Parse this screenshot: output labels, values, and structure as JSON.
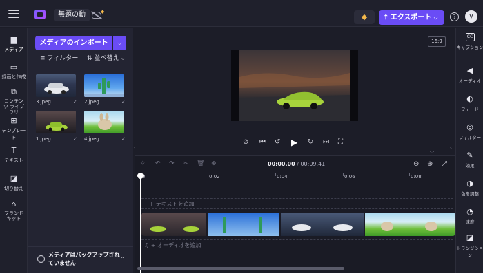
{
  "topbar": {
    "project_title": "無題の動",
    "export_label": "エクスポート",
    "avatar_initial": "y"
  },
  "leftnav": {
    "items": [
      {
        "label": "メディア",
        "icon": "folder-icon"
      },
      {
        "label": "録画と作成",
        "icon": "video-camera-icon"
      },
      {
        "label": "コンテンツ ライブラリ",
        "icon": "library-icon"
      },
      {
        "label": "テンプレート",
        "icon": "template-grid-icon"
      },
      {
        "label": "テキスト",
        "icon": "text-icon"
      },
      {
        "label": "切り替え",
        "icon": "transitions-icon"
      },
      {
        "label": "ブランド キット",
        "icon": "brand-kit-icon"
      }
    ]
  },
  "media": {
    "import_label": "メディアのインポート",
    "filter_label": "フィルター",
    "sort_label": "並べ替え",
    "files": [
      {
        "name": "3.jpeg",
        "check": "✓"
      },
      {
        "name": "2.jpeg",
        "check": "✓"
      },
      {
        "name": "1.jpeg",
        "check": "✓"
      },
      {
        "name": "4.jpeg",
        "check": "✓"
      }
    ],
    "backup_message": "メディアはバックアップされていません"
  },
  "preview": {
    "aspect_ratio": "16:9"
  },
  "rightnav": {
    "items": [
      {
        "label": "キャプション",
        "icon": "captions-icon"
      },
      {
        "label": "オーディオ",
        "icon": "speaker-icon"
      },
      {
        "label": "フェード",
        "icon": "fade-icon"
      },
      {
        "label": "フィルター",
        "icon": "filter-icon"
      },
      {
        "label": "効果",
        "icon": "magic-wand-icon"
      },
      {
        "label": "色を調整",
        "icon": "color-adjust-icon"
      },
      {
        "label": "速度",
        "icon": "speedometer-icon"
      },
      {
        "label": "トランジション",
        "icon": "transition-icon"
      }
    ]
  },
  "timeline": {
    "current_time": "00:00.00",
    "total_time": "00:09.41",
    "ruler": [
      "0",
      "0:02",
      "0:04",
      "0:06",
      "0:08"
    ],
    "text_track_label": "テキストを追加",
    "audio_track_label": "オーディオを追加"
  },
  "colors": {
    "accent": "#6a4cf5",
    "background": "#1c1d28",
    "panel": "#232432"
  }
}
